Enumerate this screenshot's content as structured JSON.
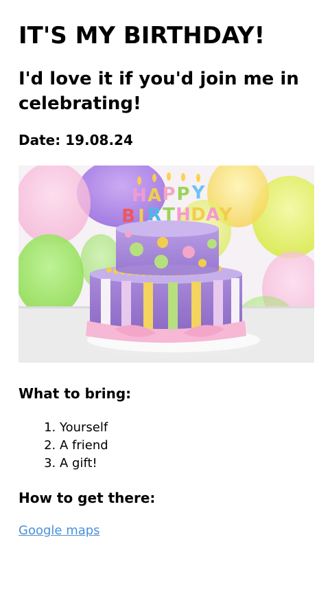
{
  "title": "IT'S MY BIRTHDAY!",
  "subtitle": "I'd love it if you'd join me in celebrating!",
  "date_line": "Date: 19.08.24",
  "image": {
    "description_icon": "birthday-cake-image",
    "cake_letters_top": "HAPPY",
    "cake_letters_bottom": "BIRTHDAY"
  },
  "bring": {
    "heading": "What to bring:",
    "items": [
      "Yourself",
      "A friend",
      "A gift!"
    ]
  },
  "directions": {
    "heading": "How to get there:",
    "link_label": "Google maps"
  },
  "colors": {
    "link": "#4a90d9",
    "text": "#000000"
  }
}
